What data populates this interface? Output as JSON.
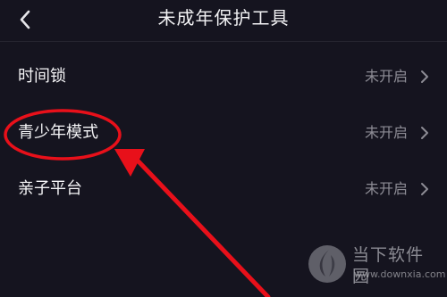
{
  "header": {
    "title": "未成年保护工具",
    "back_icon": "chevron-left-icon"
  },
  "settings": {
    "items": [
      {
        "label": "时间锁",
        "status": "未开启"
      },
      {
        "label": "青少年模式",
        "status": "未开启"
      },
      {
        "label": "亲子平台",
        "status": "未开启"
      }
    ]
  },
  "annotation": {
    "color": "#e8101a",
    "highlighted_item": "青少年模式"
  },
  "watermark": {
    "name": "当下软件园",
    "url": "www.downxia.com"
  },
  "colors": {
    "background": "#15141f",
    "text": "#f4f4f6",
    "status_text": "#8d8c95"
  }
}
